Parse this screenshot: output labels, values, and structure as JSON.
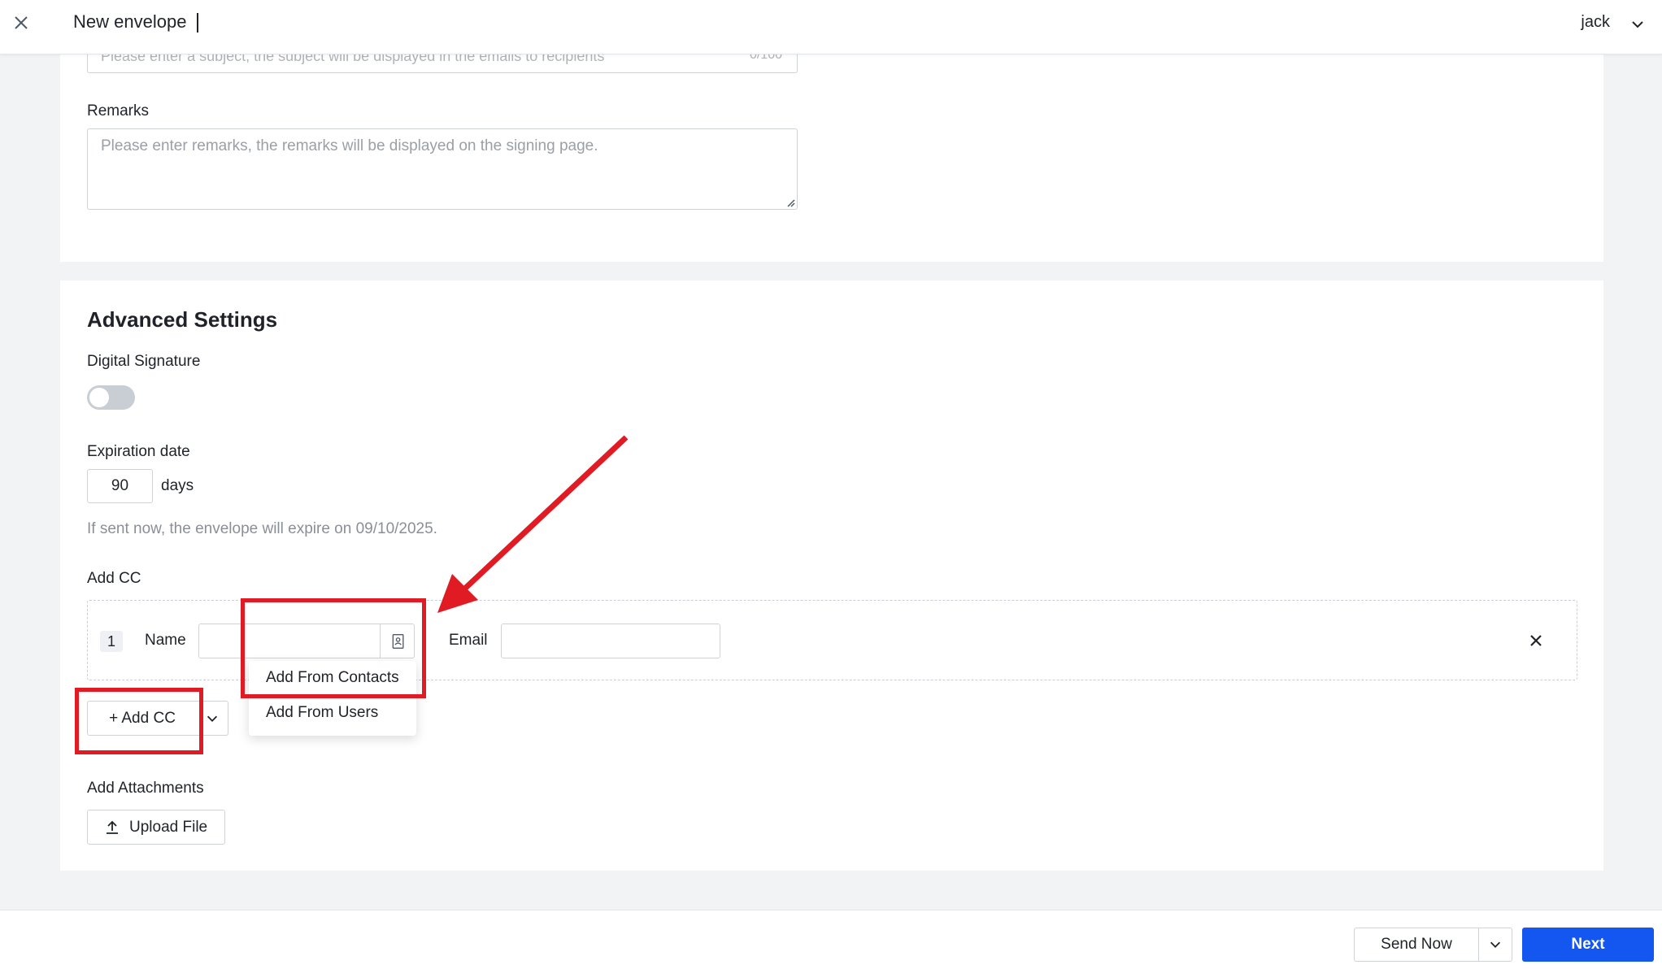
{
  "header": {
    "title": "New envelope",
    "user": "jack"
  },
  "message": {
    "subject_placeholder": "Please enter a subject, the subject will be displayed in the emails to recipients",
    "subject_count": "0/100",
    "remarks_label": "Remarks",
    "remarks_placeholder": "Please enter remarks, the remarks will be displayed on the signing page."
  },
  "advanced": {
    "title": "Advanced Settings",
    "digital_signature_label": "Digital Signature",
    "digital_signature_on": false,
    "expiration_label": "Expiration date",
    "expiration_days": "90",
    "days_unit": "days",
    "expiration_hint": "If sent now, the envelope will expire on 09/10/2025.",
    "add_cc_label": "Add CC",
    "cc_rows": [
      {
        "index": "1",
        "name_label": "Name",
        "email_label": "Email"
      }
    ],
    "add_cc_button": "+ Add CC",
    "cc_menu": [
      "Add From Contacts",
      "Add From Users"
    ],
    "attachments_label": "Add Attachments",
    "upload_button": "Upload File"
  },
  "footer": {
    "send_now": "Send Now",
    "next": "Next"
  },
  "colors": {
    "primary": "#1456f0",
    "annotation": "#e01b24"
  },
  "icons": [
    "close-icon",
    "chevron-down-icon",
    "contact-book-icon",
    "upload-icon",
    "resize-grip-icon"
  ]
}
